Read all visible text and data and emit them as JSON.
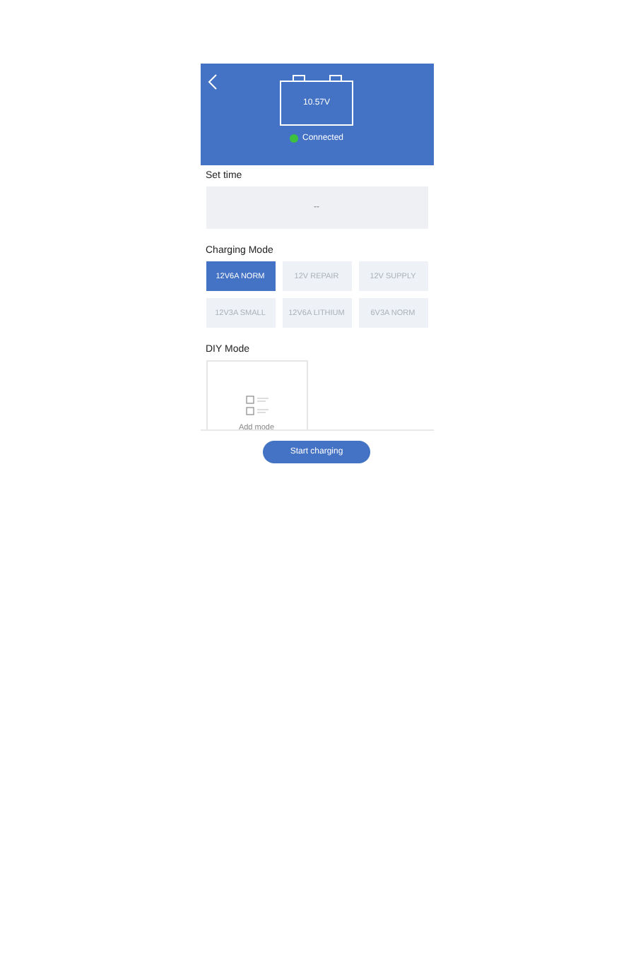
{
  "header": {
    "voltage": "10.57V",
    "status": "Connected",
    "connected": true
  },
  "set_time": {
    "label": "Set time",
    "value": "--"
  },
  "charging_mode": {
    "label": "Charging Mode",
    "modes": [
      {
        "label": "12V6A NORM",
        "selected": true
      },
      {
        "label": "12V REPAIR",
        "selected": false
      },
      {
        "label": "12V SUPPLY",
        "selected": false
      },
      {
        "label": "12V3A SMALL",
        "selected": false
      },
      {
        "label": "12V6A LITHIUM",
        "selected": false
      },
      {
        "label": "6V3A NORM",
        "selected": false
      }
    ]
  },
  "diy_mode": {
    "label": "DIY Mode",
    "add_label": "Add mode"
  },
  "start_button": "Start charging"
}
